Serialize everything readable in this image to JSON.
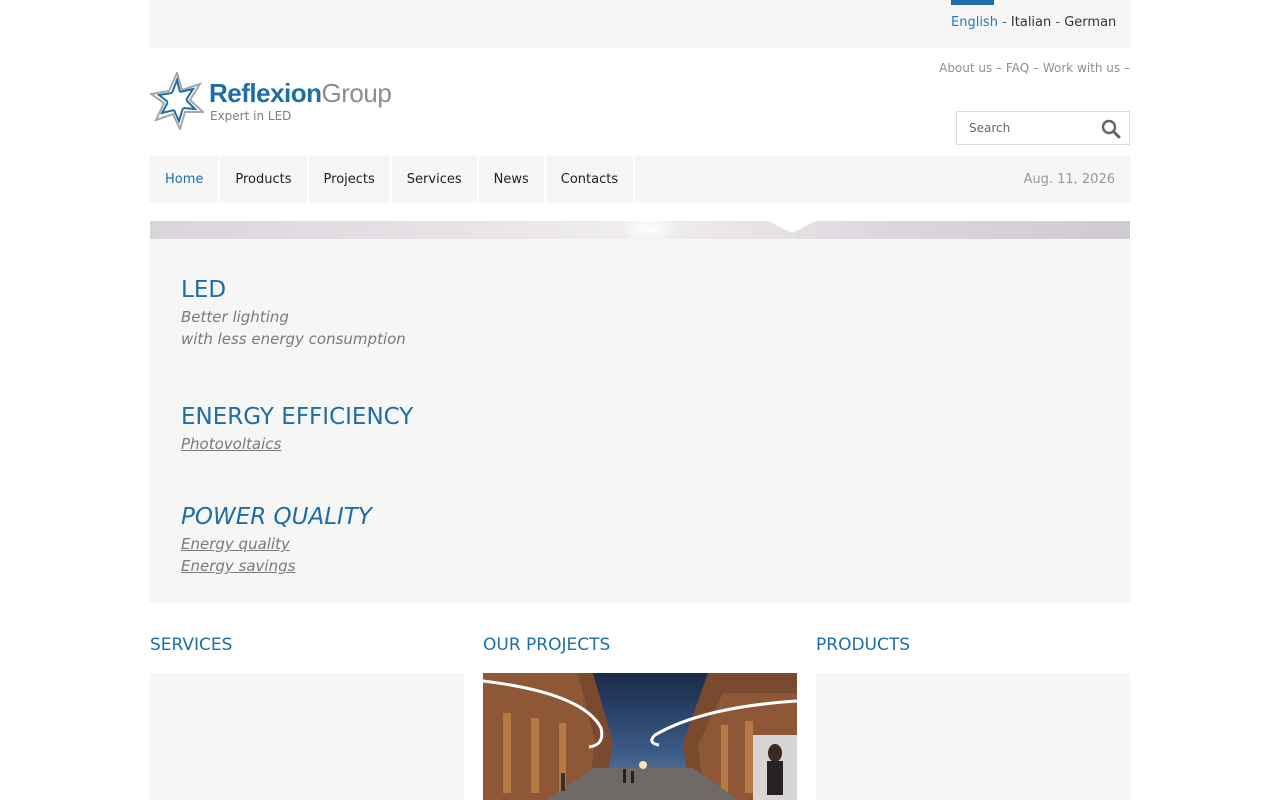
{
  "languages": {
    "active": "English",
    "others": [
      "Italian",
      "German"
    ]
  },
  "brand": {
    "name_primary": "Reflexion",
    "name_secondary": "Group",
    "tagline": "Expert in LED"
  },
  "top_links": [
    "About us",
    "FAQ",
    "Work with us"
  ],
  "search": {
    "placeholder": "Search"
  },
  "nav": {
    "items": [
      "Home",
      "Products",
      "Projects",
      "Services",
      "News",
      "Contacts"
    ],
    "active_index": 0,
    "date": "Aug. 11, 2026"
  },
  "hero": {
    "led": {
      "title": "LED",
      "lines": [
        "Better lighting",
        "with less energy consumption"
      ]
    },
    "energy": {
      "title": "ENERGY EFFICIENCY",
      "links": [
        "Photovoltaics"
      ]
    },
    "power": {
      "title": "POWER QUALITY",
      "links": [
        "Energy quality",
        "Energy savings"
      ]
    }
  },
  "columns": [
    {
      "title": "SERVICES"
    },
    {
      "title": "OUR PROJECTS"
    },
    {
      "title": "PRODUCTS"
    }
  ],
  "colors": {
    "accent": "#1d6ea7",
    "panel": "#f6f6f4",
    "muted_text": "#7a7a7a"
  },
  "icons": {
    "logo": "star-logo-icon",
    "search": "magnifier-icon"
  }
}
